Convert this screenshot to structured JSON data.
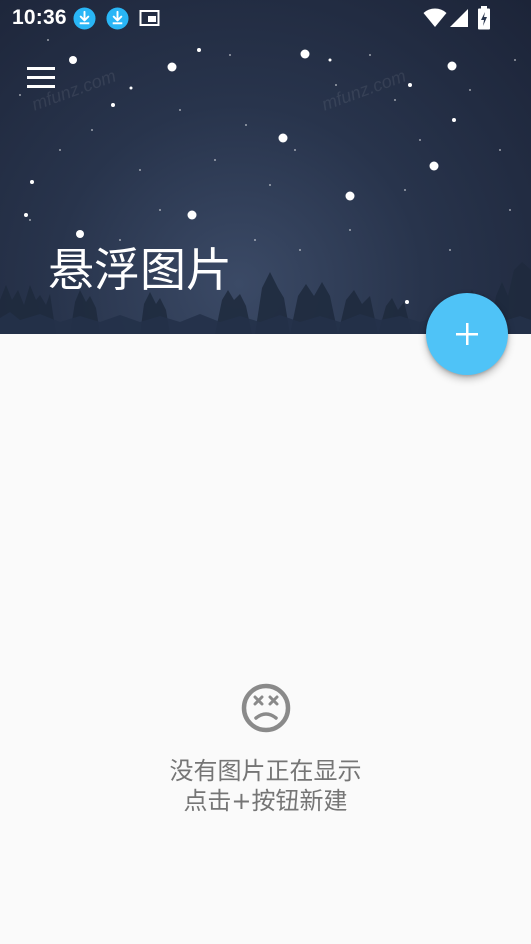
{
  "status_bar": {
    "time": "10:36",
    "left_icons": [
      "download-icon",
      "download-icon",
      "picture-in-picture-icon"
    ],
    "right_icons": [
      "wifi-icon",
      "signal-icon",
      "battery-charging-icon"
    ]
  },
  "header": {
    "title": "悬浮图片",
    "menu_icon": "hamburger-menu-icon",
    "watermark": "mfunz.com"
  },
  "fab": {
    "icon": "plus-icon",
    "color": "#4fc3f7"
  },
  "empty_state": {
    "icon": "sad-face-icon",
    "line1": "没有图片正在显示",
    "line2": "点击+按钮新建"
  },
  "colors": {
    "header_dark": "#1c2438",
    "background": "#fafafa",
    "accent": "#4fc3f7",
    "empty_text": "#757575"
  }
}
